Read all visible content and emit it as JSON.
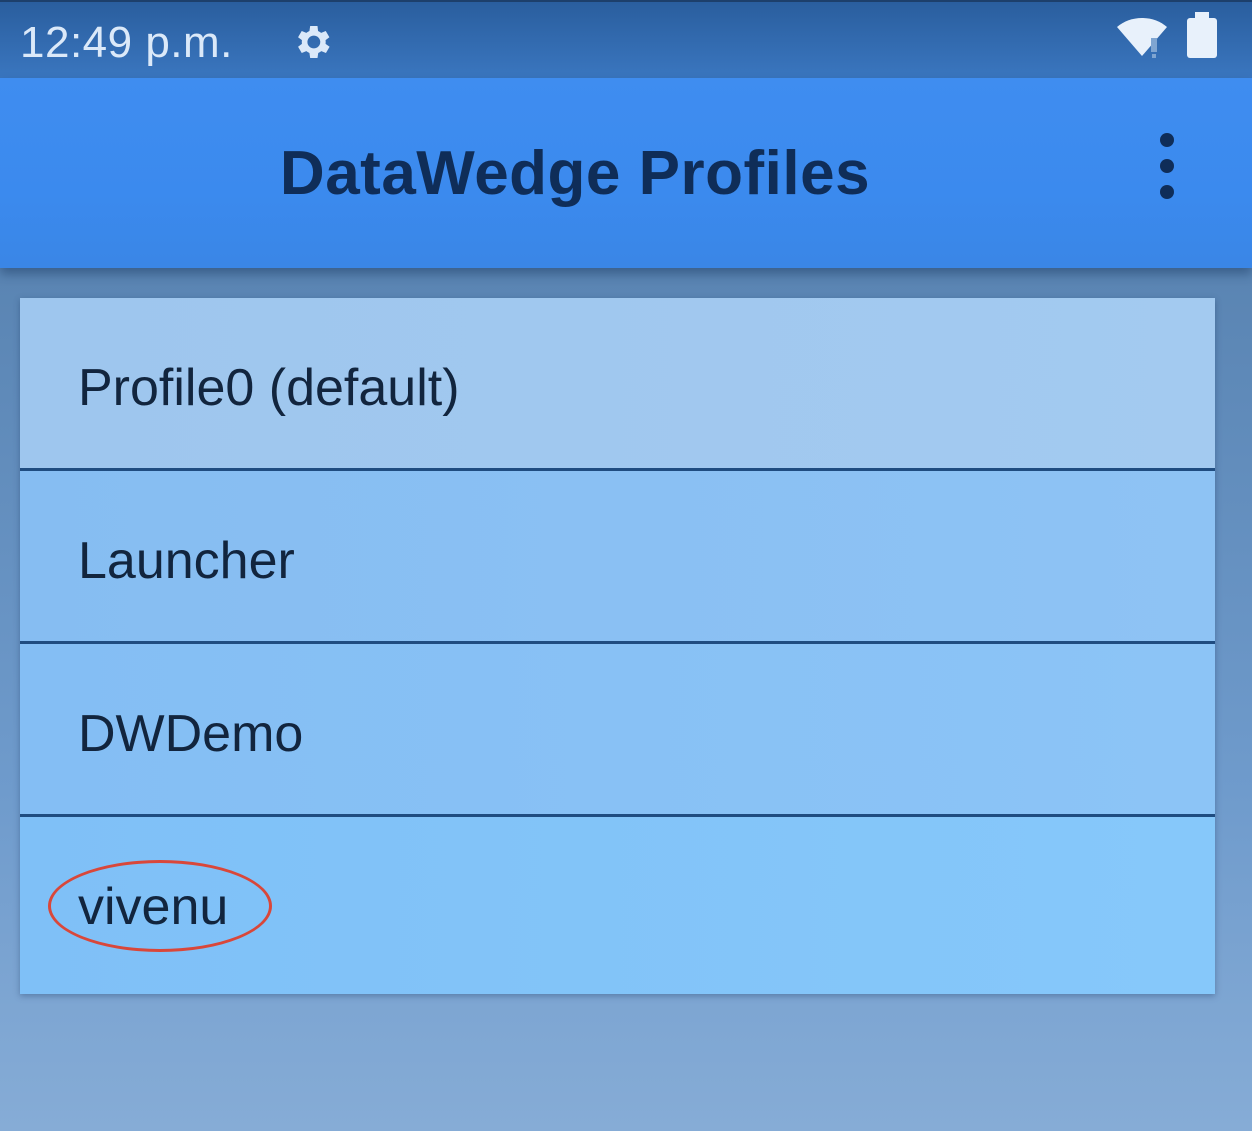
{
  "status_bar": {
    "time": "12:49 p.m.",
    "settings_icon": "gear-icon",
    "wifi_icon": "wifi-icon",
    "battery_icon": "battery-icon"
  },
  "app_bar": {
    "title": "DataWedge Profiles",
    "overflow_icon": "more-vertical-icon"
  },
  "profiles": [
    {
      "label": "Profile0 (default)"
    },
    {
      "label": "Launcher"
    },
    {
      "label": "DWDemo"
    },
    {
      "label": "vivenu"
    }
  ],
  "annotation": {
    "color": "#d9473a",
    "target": "vivenu"
  },
  "colors": {
    "app_bar": "#3b8aee",
    "title_text": "#0f2d58",
    "status_bar": "#2f68ad"
  }
}
